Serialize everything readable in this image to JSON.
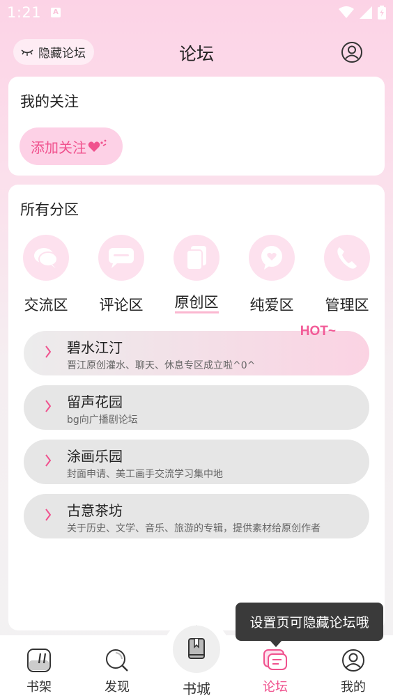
{
  "status": {
    "time": "1:21",
    "notification_icon": "A"
  },
  "header": {
    "hide_forum_label": "隐藏论坛",
    "title": "论坛"
  },
  "my_follow": {
    "title": "我的关注",
    "add_label": "添加关注"
  },
  "all_sections": {
    "title": "所有分区",
    "categories": [
      {
        "label": "交流区",
        "icon": "chat-bubbles-icon"
      },
      {
        "label": "评论区",
        "icon": "comment-icon"
      },
      {
        "label": "原创区",
        "icon": "documents-icon"
      },
      {
        "label": "纯爱区",
        "icon": "heart-bubble-icon"
      },
      {
        "label": "管理区",
        "icon": "phone-icon"
      }
    ],
    "forums": [
      {
        "name": "碧水江汀",
        "desc": "晋江原创灌水、聊天、休息专区成立啦^0^",
        "tag": "HOT~"
      },
      {
        "name": "留声花园",
        "desc": "bg向广播剧论坛"
      },
      {
        "name": "涂画乐园",
        "desc": "封面申请、美工画手交流学习集中地"
      },
      {
        "name": "古意茶坊",
        "desc": "关于历史、文学、音乐、旅游的专辑，提供素材给原创作者"
      }
    ]
  },
  "tooltip": "设置页可隐藏论坛哦",
  "nav": {
    "bookshelf": "书架",
    "discover": "发现",
    "bookstore": "书城",
    "forum": "论坛",
    "mine": "我的"
  },
  "colors": {
    "accent": "#f0528e",
    "pink_light": "#fde1ee",
    "header_bg": "#fcd3e6"
  }
}
